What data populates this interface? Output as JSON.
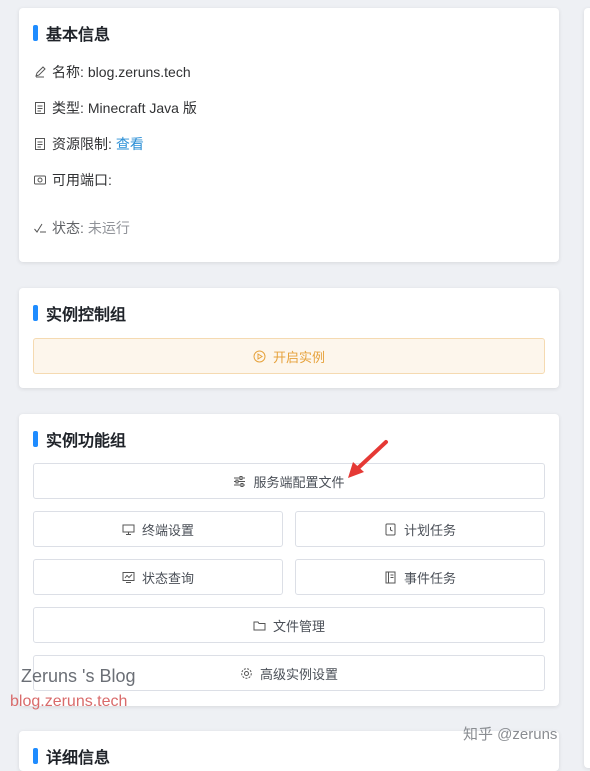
{
  "basic_info": {
    "title": "基本信息",
    "rows": [
      {
        "label": "名称:",
        "value": "blog.zeruns.tech"
      },
      {
        "label": "类型:",
        "value": "Minecraft Java 版"
      },
      {
        "label": "资源限制:",
        "value": "查看"
      },
      {
        "label": "可用端口:",
        "value": ""
      },
      {
        "label": "状态:",
        "value": "未运行"
      }
    ]
  },
  "control_group": {
    "title": "实例控制组",
    "start_label": "开启实例"
  },
  "function_group": {
    "title": "实例功能组",
    "server_config": "服务端配置文件",
    "terminal_settings": "终端设置",
    "scheduled_tasks": "计划任务",
    "status_query": "状态查询",
    "event_tasks": "事件任务",
    "file_management": "文件管理",
    "advanced_settings": "高级实例设置"
  },
  "detail_info": {
    "title": "详细信息"
  },
  "watermarks": {
    "line1": "Zeruns 's Blog",
    "line2": "blog.zeruns.tech",
    "line3": "知乎 @zeruns"
  },
  "colors": {
    "accent": "#1f8cff",
    "link": "#2b8fd6",
    "warning": "#e6a23c",
    "warning_bg": "#fdf6ec",
    "arrow": "#e53935"
  }
}
